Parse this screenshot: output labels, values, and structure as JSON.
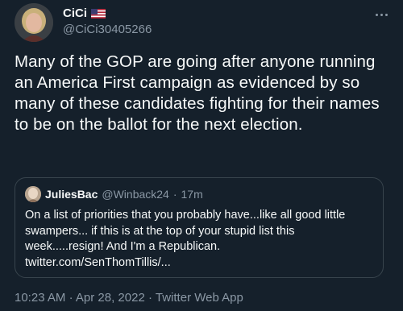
{
  "author": {
    "display_name": "CiCi",
    "flag": "🇺🇸",
    "handle": "@CiCi30405266"
  },
  "tweet": {
    "text": "Many of the GOP are going after anyone running an America First campaign as evidenced by so many of these candidates fighting for their names to be on the ballot for the next election."
  },
  "quoted": {
    "display_name": "JuliesBac",
    "handle": "@Winback24",
    "separator": "·",
    "time": "17m",
    "text_line1": "On a list of priorities that you probably have...like all good little",
    "text_line2": "swampers... if this is at the top of your stupid list this",
    "text_line3": "week.....resign! And I'm a Republican.",
    "text_line4": "twitter.com/SenThomTillis/..."
  },
  "meta": {
    "time": "10:23 AM",
    "sep1": "·",
    "date": "Apr 28, 2022",
    "sep2": "·",
    "source": "Twitter Web App"
  },
  "colors": {
    "background": "#15202b",
    "text": "#f7f9f9",
    "secondary": "#8b98a5",
    "border": "#38444d"
  },
  "icons": {
    "more": "more-horizontal-icon",
    "flag": "us-flag-icon"
  }
}
